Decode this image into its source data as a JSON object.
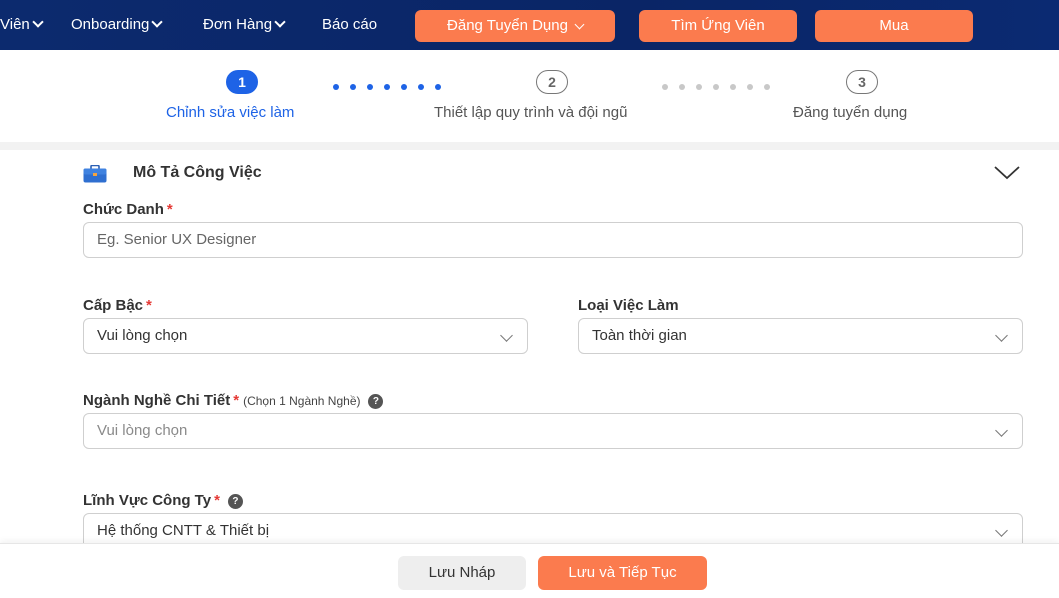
{
  "nav": {
    "links": [
      {
        "label": "Viên"
      },
      {
        "label": "Onboarding"
      },
      {
        "label": "Đơn Hàng"
      },
      {
        "label": "Báo cáo"
      }
    ],
    "post_job_label": "Đăng Tuyển Dụng",
    "find_candidates_label": "Tìm Ứng Viên",
    "buy_label": "Mua"
  },
  "stepper": {
    "steps": [
      {
        "number": "1",
        "label": "Chỉnh sửa việc làm",
        "state": "active"
      },
      {
        "number": "2",
        "label": "Thiết lập quy trình và đội ngũ",
        "state": "inactive"
      },
      {
        "number": "3",
        "label": "Đăng tuyển dụng",
        "state": "inactive"
      }
    ]
  },
  "section": {
    "title": "Mô Tả Công Việc",
    "icon": "briefcase-icon"
  },
  "form": {
    "job_title": {
      "label": "Chức Danh",
      "required": "*",
      "placeholder": "Eg. Senior UX Designer"
    },
    "level": {
      "label": "Cấp Bậc",
      "required": "*",
      "value": "Vui lòng chọn"
    },
    "job_type": {
      "label": "Loại Việc Làm",
      "value": "Toàn thời gian"
    },
    "industry": {
      "label": "Ngành Nghề Chi Tiết",
      "required": "*",
      "hint": "(Chọn 1 Ngành Nghề)",
      "value": "Vui lòng chọn",
      "help": "?"
    },
    "company_field": {
      "label": "Lĩnh Vực Công Ty",
      "required": "*",
      "value": "Hệ thống CNTT & Thiết bị",
      "help": "?"
    }
  },
  "footer": {
    "save_draft_label": "Lưu Nháp",
    "save_continue_label": "Lưu và Tiếp Tục"
  },
  "colors": {
    "nav_bg": "#0a2566",
    "accent_orange": "#fb7b4e",
    "active_blue": "#1e63e6",
    "required_red": "#e53935"
  }
}
